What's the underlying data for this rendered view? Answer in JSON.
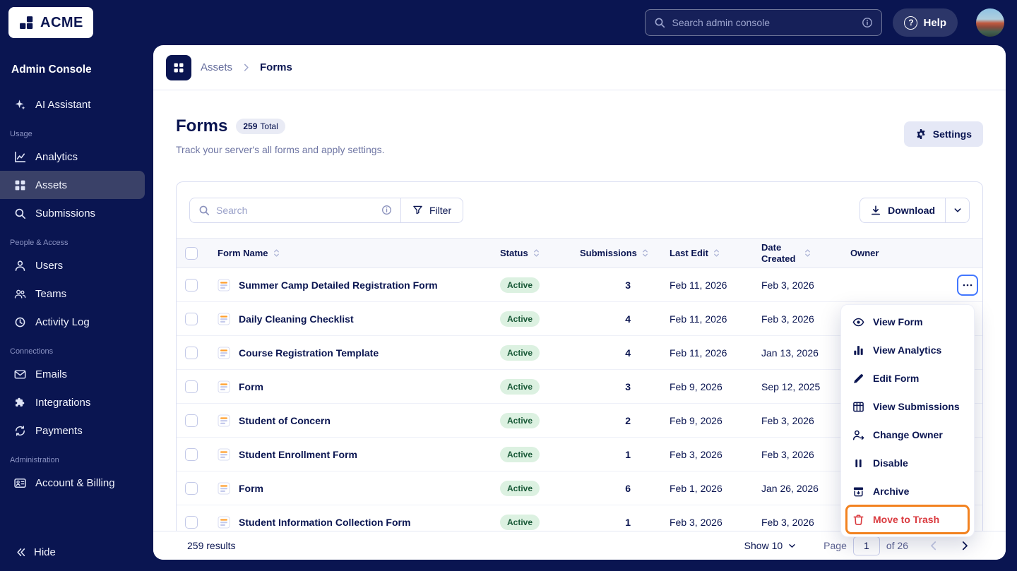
{
  "topbar": {
    "logo": "ACME",
    "search_placeholder": "Search admin console",
    "help": "Help",
    "help_icon": "?"
  },
  "sidebar": {
    "title": "Admin Console",
    "ai_assistant": "AI Assistant",
    "section_usage": "Usage",
    "analytics": "Analytics",
    "assets": "Assets",
    "submissions": "Submissions",
    "section_people": "People & Access",
    "users": "Users",
    "teams": "Teams",
    "activity_log": "Activity Log",
    "section_connections": "Connections",
    "emails": "Emails",
    "integrations": "Integrations",
    "payments": "Payments",
    "section_admin": "Administration",
    "account_billing": "Account & Billing",
    "hide": "Hide"
  },
  "breadcrumb": {
    "parent": "Assets",
    "current": "Forms"
  },
  "header": {
    "title": "Forms",
    "badge_count": "259",
    "badge_label": "Total",
    "subtitle": "Track your server's all forms and apply settings.",
    "settings": "Settings"
  },
  "toolbar": {
    "search_placeholder": "Search",
    "filter": "Filter",
    "download": "Download"
  },
  "table": {
    "columns": [
      "Form Name",
      "Status",
      "Submissions",
      "Last Edit",
      "Date Created",
      "Owner"
    ],
    "rows": [
      {
        "name": "Summer Camp Detailed Registration Form",
        "status": "Active",
        "submissions": "3",
        "last_edit": "Feb 11, 2026",
        "date_created": "Feb 3, 2026",
        "owner_redacted": true
      },
      {
        "name": "Daily Cleaning Checklist",
        "status": "Active",
        "submissions": "4",
        "last_edit": "Feb 11, 2026",
        "date_created": "Feb 3, 2026"
      },
      {
        "name": "Course Registration Template",
        "status": "Active",
        "submissions": "4",
        "last_edit": "Feb 11, 2026",
        "date_created": "Jan 13, 2026"
      },
      {
        "name": "Form",
        "status": "Active",
        "submissions": "3",
        "last_edit": "Feb 9, 2026",
        "date_created": "Sep 12, 2025"
      },
      {
        "name": "Student of Concern",
        "status": "Active",
        "submissions": "2",
        "last_edit": "Feb 9, 2026",
        "date_created": "Feb 3, 2026"
      },
      {
        "name": "Student Enrollment Form",
        "status": "Active",
        "submissions": "1",
        "last_edit": "Feb 3, 2026",
        "date_created": "Feb 3, 2026"
      },
      {
        "name": "Form",
        "status": "Active",
        "submissions": "6",
        "last_edit": "Feb 1, 2026",
        "date_created": "Jan 26, 2026"
      },
      {
        "name": "Student Information Collection Form",
        "status": "Active",
        "submissions": "1",
        "last_edit": "Feb 3, 2026",
        "date_created": "Feb 3, 2026"
      }
    ]
  },
  "menu": {
    "items": [
      {
        "label": "View Form",
        "icon": "eye-icon"
      },
      {
        "label": "View Analytics",
        "icon": "bar-chart-icon"
      },
      {
        "label": "Edit Form",
        "icon": "pencil-icon"
      },
      {
        "label": "View Submissions",
        "icon": "table-icon"
      },
      {
        "label": "Change Owner",
        "icon": "change-owner-icon"
      },
      {
        "label": "Disable",
        "icon": "pause-icon"
      },
      {
        "label": "Archive",
        "icon": "archive-icon"
      },
      {
        "label": "Move to Trash",
        "icon": "trash-icon",
        "danger": true,
        "highlighted": true
      }
    ]
  },
  "footer": {
    "results": "259 results",
    "show": "Show 10",
    "page_label": "Page",
    "page_value": "1",
    "of": "of 26"
  },
  "colors": {
    "navy": "#0A1551",
    "accent_orange": "#F28220",
    "danger_red": "#DA3A3F",
    "focus_blue": "#4277FF",
    "badge_green_bg": "#DCF1E1",
    "badge_green_text": "#1A5A38",
    "sidebar_active": "#3A4168"
  }
}
